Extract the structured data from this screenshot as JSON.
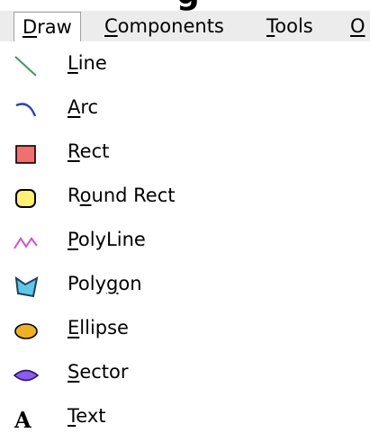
{
  "window": {
    "title_fragment": "g"
  },
  "menubar": {
    "items": [
      {
        "label": "Draw",
        "mnemonic_index": 0,
        "active": true
      },
      {
        "label": "Components",
        "mnemonic_index": 0,
        "active": false
      },
      {
        "label": "Tools",
        "mnemonic_index": 0,
        "active": false
      },
      {
        "label": "O",
        "mnemonic_index": 0,
        "active": false
      }
    ]
  },
  "draw_menu": {
    "items": [
      {
        "label": "Line",
        "mnemonic_index": 0,
        "icon": "line-icon",
        "color": "#3a9a5b"
      },
      {
        "label": "Arc",
        "mnemonic_index": 0,
        "icon": "arc-icon",
        "color": "#2a3bd6"
      },
      {
        "label": "Rect",
        "mnemonic_index": 0,
        "icon": "rect-icon",
        "color": "#f07070"
      },
      {
        "label": "Round Rect",
        "mnemonic_index": 1,
        "icon": "round-rect-icon",
        "color": "#fff176"
      },
      {
        "label": "PolyLine",
        "mnemonic_index": 0,
        "icon": "polyline-icon",
        "color": "#d04fd6"
      },
      {
        "label": "Polygon",
        "mnemonic_index": 4,
        "icon": "polygon-icon",
        "color": "#5ec8e8"
      },
      {
        "label": "Ellipse",
        "mnemonic_index": 0,
        "icon": "ellipse-icon",
        "color": "#f0b020"
      },
      {
        "label": "Sector",
        "mnemonic_index": 0,
        "icon": "sector-icon",
        "color": "#8a5cf0"
      },
      {
        "label": "Text",
        "mnemonic_index": 0,
        "icon": "text-icon",
        "glyph": "A",
        "color": "#000000"
      }
    ]
  }
}
